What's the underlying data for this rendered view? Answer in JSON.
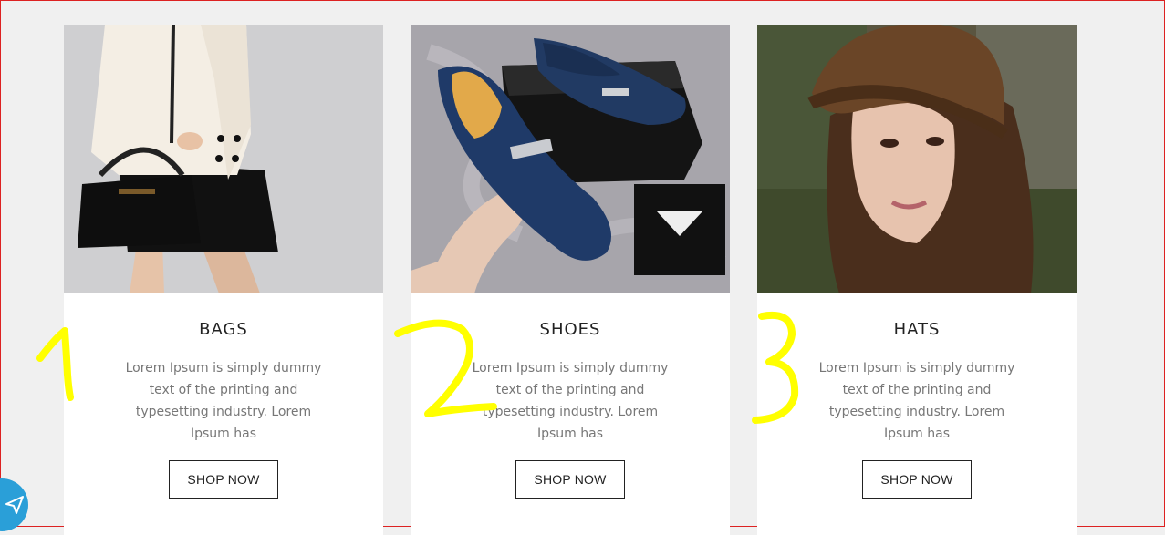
{
  "products": [
    {
      "title": "BAGS",
      "description": "Lorem Ipsum is simply dummy text of the printing and typesetting industry. Lorem Ipsum has",
      "button_label": "SHOP NOW",
      "image": "woman-with-black-handbag"
    },
    {
      "title": "SHOES",
      "description": "Lorem Ipsum is simply dummy text of the printing and typesetting industry. Lorem Ipsum has",
      "button_label": "SHOP NOW",
      "image": "blue-suede-loafers-with-box"
    },
    {
      "title": "HATS",
      "description": "Lorem Ipsum is simply dummy text of the printing and typesetting industry. Lorem Ipsum has",
      "button_label": "SHOP NOW",
      "image": "woman-in-brown-hat"
    }
  ],
  "annotations": [
    "1",
    "2",
    "3"
  ],
  "annotation_color": "#ffff00",
  "floating_button_icon": "send-icon",
  "colors": {
    "background": "#f0f0f0",
    "card": "#ffffff",
    "text": "#222222",
    "muted": "#777777",
    "accent": "#2a9fd8"
  }
}
